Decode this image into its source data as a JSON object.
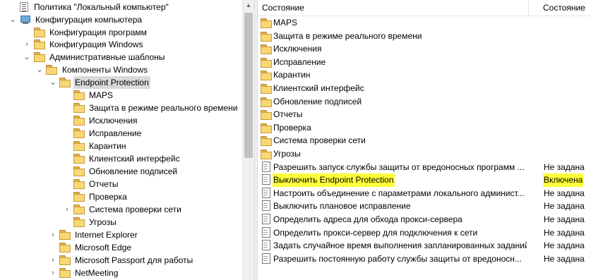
{
  "tree": {
    "items": [
      {
        "label": "Политика \"Локальный компьютер\"",
        "icon": "policy-icon",
        "expander": ""
      },
      {
        "label": "Конфигурация компьютера",
        "icon": "computer-icon",
        "expander": "⌄"
      },
      {
        "label": "Конфигурация программ",
        "icon": "folder-icon",
        "expander": ""
      },
      {
        "label": "Конфигурация Windows",
        "icon": "folder-icon",
        "expander": "›"
      },
      {
        "label": "Административные шаблоны",
        "icon": "folder-icon",
        "expander": "⌄"
      },
      {
        "label": "Компоненты Windows",
        "icon": "folder-icon",
        "expander": "⌄"
      },
      {
        "label": "Endpoint Protection",
        "icon": "folder-icon",
        "expander": "⌄"
      },
      {
        "label": "MAPS",
        "icon": "folder-icon",
        "expander": ""
      },
      {
        "label": "Защита в режиме реального времени",
        "icon": "folder-icon",
        "expander": ""
      },
      {
        "label": "Исключения",
        "icon": "folder-icon",
        "expander": ""
      },
      {
        "label": "Исправление",
        "icon": "folder-icon",
        "expander": ""
      },
      {
        "label": "Карантин",
        "icon": "folder-icon",
        "expander": ""
      },
      {
        "label": "Клиентский интерфейс",
        "icon": "folder-icon",
        "expander": ""
      },
      {
        "label": "Обновление подписей",
        "icon": "folder-icon",
        "expander": ""
      },
      {
        "label": "Отчеты",
        "icon": "folder-icon",
        "expander": ""
      },
      {
        "label": "Проверка",
        "icon": "folder-icon",
        "expander": ""
      },
      {
        "label": "Система проверки сети",
        "icon": "folder-icon",
        "expander": "›"
      },
      {
        "label": "Угрозы",
        "icon": "folder-icon",
        "expander": ""
      },
      {
        "label": "Internet Explorer",
        "icon": "folder-icon",
        "expander": "›"
      },
      {
        "label": "Microsoft Edge",
        "icon": "folder-icon",
        "expander": ""
      },
      {
        "label": "Microsoft Passport для работы",
        "icon": "folder-icon",
        "expander": "›"
      },
      {
        "label": "NetMeeting",
        "icon": "folder-icon",
        "expander": "›"
      }
    ],
    "selected": "Endpoint Protection"
  },
  "list": {
    "header": {
      "name": "Состояние",
      "state": "Состояние"
    },
    "rows": [
      {
        "name": "MAPS",
        "state": "",
        "icon": "folder-icon"
      },
      {
        "name": "Защита в режиме реального времени",
        "state": "",
        "icon": "folder-icon"
      },
      {
        "name": "Исключения",
        "state": "",
        "icon": "folder-icon"
      },
      {
        "name": "Исправление",
        "state": "",
        "icon": "folder-icon"
      },
      {
        "name": "Карантин",
        "state": "",
        "icon": "folder-icon"
      },
      {
        "name": "Клиентский интерфейс",
        "state": "",
        "icon": "folder-icon"
      },
      {
        "name": "Обновление подписей",
        "state": "",
        "icon": "folder-icon"
      },
      {
        "name": "Отчеты",
        "state": "",
        "icon": "folder-icon"
      },
      {
        "name": "Проверка",
        "state": "",
        "icon": "folder-icon"
      },
      {
        "name": "Система проверки сети",
        "state": "",
        "icon": "folder-icon"
      },
      {
        "name": "Угрозы",
        "state": "",
        "icon": "folder-icon"
      },
      {
        "name": "Разрешить запуск службы защиты от вредоносных программ ...",
        "state": "Не задана",
        "icon": "policy-setting-icon"
      },
      {
        "name": "Выключить Endpoint Protection",
        "state": "Включена",
        "icon": "policy-setting-icon",
        "highlight": true
      },
      {
        "name": "Настроить объединение с параметрами локального админист...",
        "state": "Не задана",
        "icon": "policy-setting-icon"
      },
      {
        "name": "Выключить плановое исправление",
        "state": "Не задана",
        "icon": "policy-setting-icon"
      },
      {
        "name": "Определить адреса для обхода прокси-сервера",
        "state": "Не задана",
        "icon": "policy-setting-icon"
      },
      {
        "name": "Определить прокси-сервер для подключения к сети",
        "state": "Не задана",
        "icon": "policy-setting-icon"
      },
      {
        "name": "Задать случайное время выполнения запланированных заданий",
        "state": "Не задана",
        "icon": "policy-setting-icon"
      },
      {
        "name": "Разрешить постоянную работу службы защиты от вредоносн...",
        "state": "Не задана",
        "icon": "policy-setting-icon"
      }
    ]
  },
  "colors": {
    "highlight": "#ffff3a",
    "selection": "#d9d9d9",
    "folder": "#f8d775"
  }
}
